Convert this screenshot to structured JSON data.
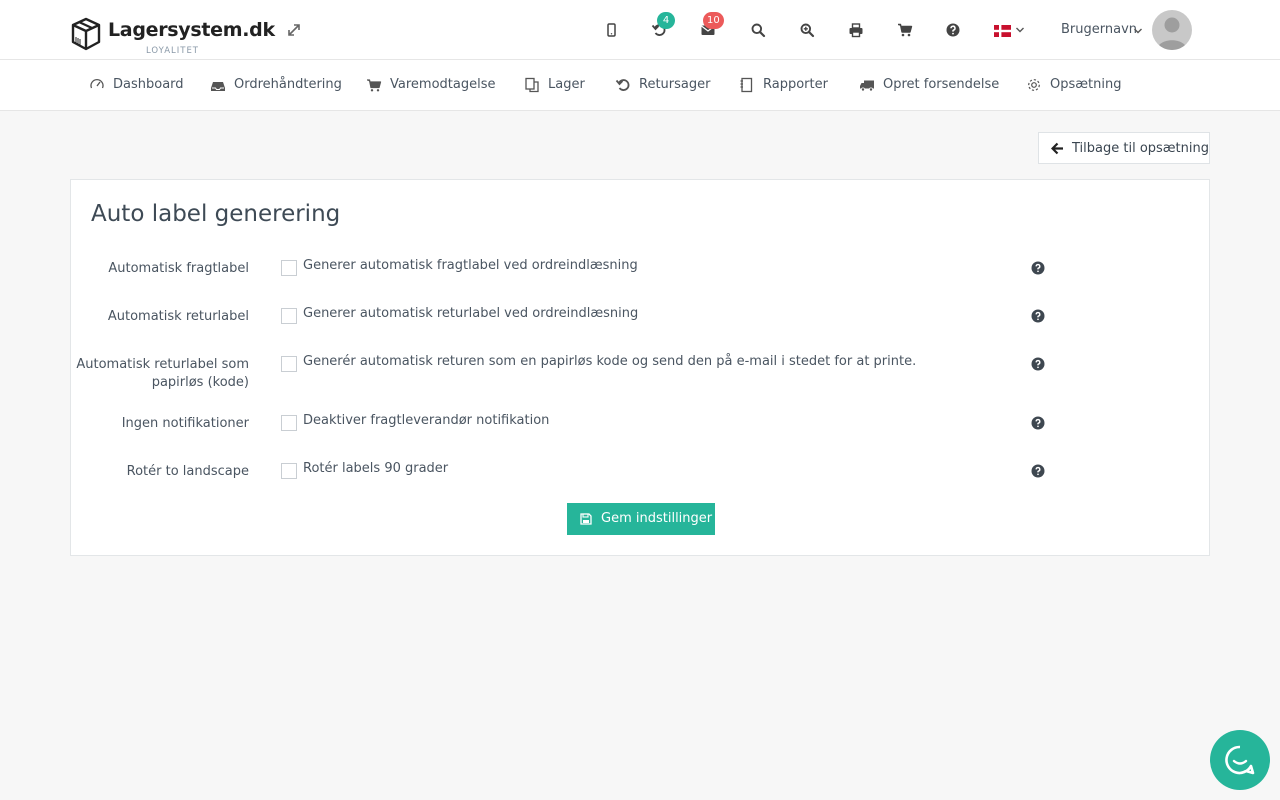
{
  "brand": {
    "name": "Lagersystem.dk",
    "tagline": "LOYALITET"
  },
  "topbar": {
    "icons": [
      "expand-icon",
      "mobile-icon",
      "undo-icon",
      "envelope-icon",
      "search-icon",
      "zoom-in-icon",
      "print-icon",
      "cart-icon",
      "question-icon"
    ],
    "returns_badge": "4",
    "messages_badge": "10",
    "language_flag": "Denmark",
    "username": "Brugernavn"
  },
  "nav": {
    "items": [
      {
        "label": "Dashboard",
        "icon": "dashboard-icon"
      },
      {
        "label": "Ordrehåndtering",
        "icon": "inbox-icon"
      },
      {
        "label": "Varemodtagelse",
        "icon": "cart-icon"
      },
      {
        "label": "Lager",
        "icon": "copy-icon"
      },
      {
        "label": "Retursager",
        "icon": "undo-icon"
      },
      {
        "label": "Rapporter",
        "icon": "notebook-icon"
      },
      {
        "label": "Opret forsendelse",
        "icon": "truck-icon"
      },
      {
        "label": "Opsætning",
        "icon": "gear-icon"
      }
    ]
  },
  "back_button": {
    "label": "Tilbage til opsætning"
  },
  "panel": {
    "title": "Auto label generering",
    "rows": [
      {
        "label": "Automatisk fragtlabel",
        "checkbox_label": "Generer automatisk fragtlabel ved ordreindlæsning",
        "checked": false
      },
      {
        "label": "Automatisk returlabel",
        "checkbox_label": "Generer automatisk returlabel ved ordreindlæsning",
        "checked": false
      },
      {
        "label_line1": "Automatisk returlabel som",
        "label_line2": "papirløs (kode)",
        "checkbox_label": "Generér automatisk returen som en papirløs kode og send den på e-mail i stedet for at printe.",
        "checked": false
      },
      {
        "label": "Ingen notifikationer",
        "checkbox_label": "Deaktiver fragtleverandør notifikation",
        "checked": false
      },
      {
        "label": "Rotér to landscape",
        "checkbox_label": "Rotér labels 90 grader",
        "checked": false
      }
    ],
    "save_label": "Gem indstillinger"
  },
  "colors": {
    "accent": "#26b59a",
    "badge_red": "#ec5a5a",
    "text": "#4a5561"
  }
}
